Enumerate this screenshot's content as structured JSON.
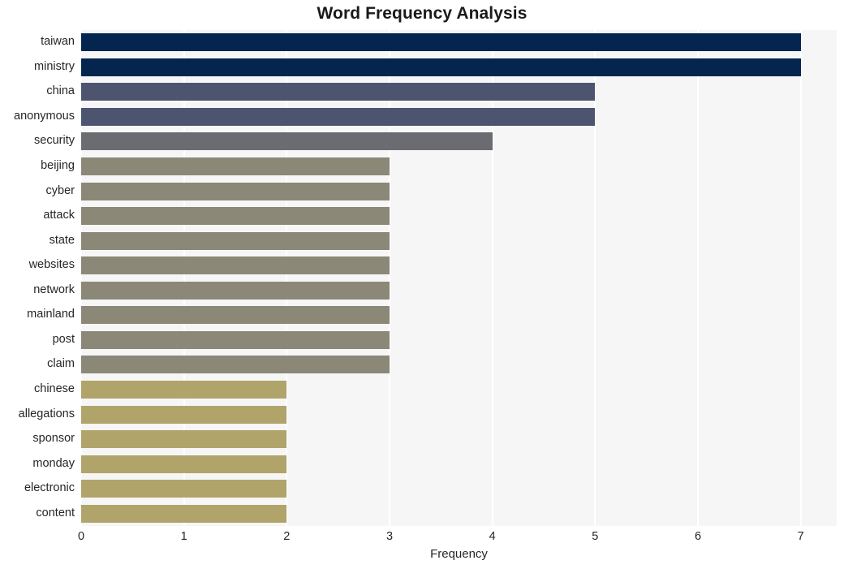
{
  "chart_data": {
    "type": "bar",
    "orientation": "horizontal",
    "title": "Word Frequency Analysis",
    "xlabel": "Frequency",
    "ylabel": "",
    "xlim": [
      0,
      7.35
    ],
    "xticks": [
      0,
      1,
      2,
      3,
      4,
      5,
      6,
      7
    ],
    "xtick_labels": [
      "0",
      "1",
      "2",
      "3",
      "4",
      "5",
      "6",
      "7"
    ],
    "grid": true,
    "grid_axis": "x",
    "legend": false,
    "categories": [
      "taiwan",
      "ministry",
      "china",
      "anonymous",
      "security",
      "beijing",
      "cyber",
      "attack",
      "state",
      "websites",
      "network",
      "mainland",
      "post",
      "claim",
      "chinese",
      "allegations",
      "sponsor",
      "monday",
      "electronic",
      "content"
    ],
    "values": [
      7,
      7,
      5,
      5,
      4,
      3,
      3,
      3,
      3,
      3,
      3,
      3,
      3,
      3,
      2,
      2,
      2,
      2,
      2,
      2
    ],
    "bar_colors": [
      "#03254e",
      "#03254e",
      "#4d546f",
      "#4d546f",
      "#6b6c72",
      "#8b8878",
      "#8b8878",
      "#8b8878",
      "#8b8878",
      "#8b8878",
      "#8b8878",
      "#8b8878",
      "#8b8878",
      "#8b8878",
      "#b0a46a",
      "#b0a46a",
      "#b0a46a",
      "#b0a46a",
      "#b0a46a",
      "#b0a46a"
    ]
  },
  "style": {
    "figure_background": "#ffffff",
    "plot_background": "#f6f6f7",
    "gridline_color": "#ffffff",
    "text_color": "#262626",
    "title_color": "#1a1a1a"
  }
}
